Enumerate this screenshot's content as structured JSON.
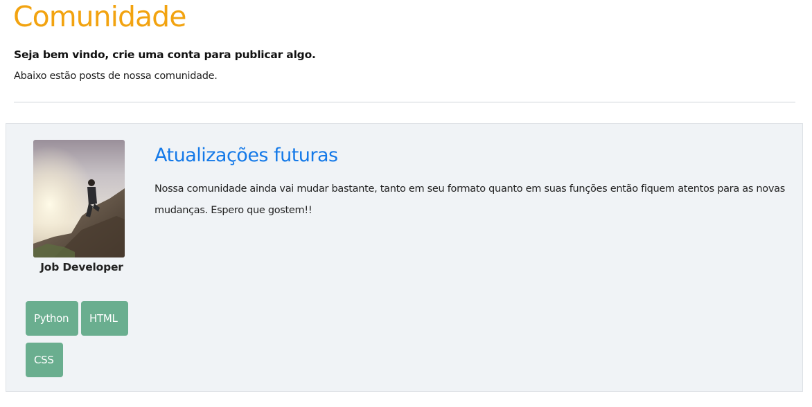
{
  "header": {
    "title": "Comunidade",
    "welcome": "Seja bem vindo, crie uma conta para publicar algo.",
    "subtitle": "Abaixo estão posts de nossa comunidade."
  },
  "post": {
    "author": "Job Developer",
    "avatar_icon": "person-on-rocks-photo",
    "title": "Atualizações futuras",
    "body": "Nossa comunidade ainda vai mudar bastante, tanto em seu formato quanto em suas funções então fiquem atentos para as novas mudanças. Espero que gostem!!",
    "tags": [
      "Python",
      "HTML",
      "CSS"
    ]
  },
  "colors": {
    "title_orange": "#f2a310",
    "link_blue": "#1479e8",
    "tag_green": "#6aae8f",
    "card_bg": "#f0f3f6"
  }
}
